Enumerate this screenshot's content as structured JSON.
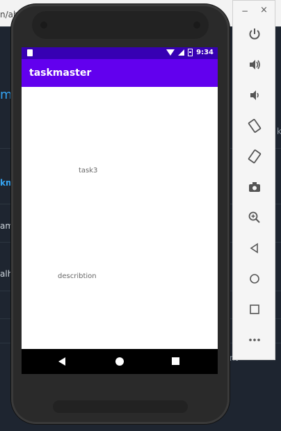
{
  "background": {
    "url_fragment": "n/abe",
    "fragments": [
      {
        "text": "m",
        "style": "bigblue"
      },
      {
        "text": "km",
        "style": "blue"
      },
      {
        "text": "ami",
        "style": "plain"
      },
      {
        "text": "alh",
        "style": "plain"
      },
      {
        "text": "k",
        "style": "dim"
      },
      {
        "text": "nt",
        "style": "dim"
      }
    ]
  },
  "status_bar": {
    "time": "9:34"
  },
  "app": {
    "title": "taskmaster",
    "task_title": "task3",
    "task_description": "describtion"
  },
  "emulator_toolbar": {
    "minimize_label": "−",
    "close_label": "×",
    "buttons": [
      {
        "name": "power-icon",
        "glyph": "⏻"
      },
      {
        "name": "volume-up-icon",
        "glyph": "🔊"
      },
      {
        "name": "volume-down-icon",
        "glyph": "🔉"
      },
      {
        "name": "rotate-left-icon",
        "glyph": "⟲"
      },
      {
        "name": "rotate-right-icon",
        "glyph": "⟳"
      },
      {
        "name": "camera-icon",
        "glyph": "📷"
      },
      {
        "name": "zoom-icon",
        "glyph": "⊕"
      },
      {
        "name": "back-icon",
        "glyph": "◁"
      },
      {
        "name": "home-icon",
        "glyph": "○"
      },
      {
        "name": "overview-icon",
        "glyph": "□"
      },
      {
        "name": "more-icon",
        "glyph": "•••"
      }
    ]
  },
  "colors": {
    "status_bar": "#3700b3",
    "app_bar": "#6200ee",
    "nav_bar": "#000000"
  }
}
